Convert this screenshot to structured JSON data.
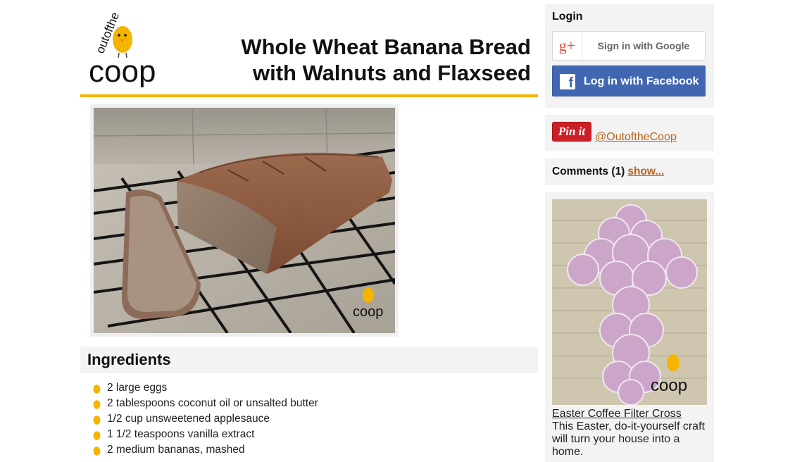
{
  "recipe": {
    "title_line1": "Whole Wheat Banana Bread",
    "title_line2": "with Walnuts and Flaxseed",
    "ingredients_heading": "Ingredients",
    "ingredients": [
      "2 large eggs",
      "2 tablespoons coconut oil or unsalted butter",
      "1/2 cup unsweetened applesauce",
      "1 1/2 teaspoons vanilla extract",
      "2 medium bananas, mashed"
    ]
  },
  "brand": {
    "logo_top": "outofthe",
    "logo_bottom": "coop",
    "accent_color": "#f4b400"
  },
  "sidebar": {
    "login_heading": "Login",
    "google_label": "Sign in with Google",
    "google_icon": "g+",
    "facebook_label": "Log in with Facebook",
    "facebook_icon": "f",
    "pinterest_button": "Pin it",
    "pinterest_handle": "@OutoftheCoop",
    "comments_label": "Comments (1)",
    "comments_show": "show...",
    "promo": {
      "title": "Easter Coffee Filter Cross",
      "description": "This Easter, do-it-yourself craft will turn your house into a home."
    }
  },
  "colors": {
    "link": "#b5651d",
    "facebook": "#4267b2",
    "google_red": "#dd4b39",
    "pinterest": "#cb2027",
    "panel_bg": "#f3f3f3"
  }
}
